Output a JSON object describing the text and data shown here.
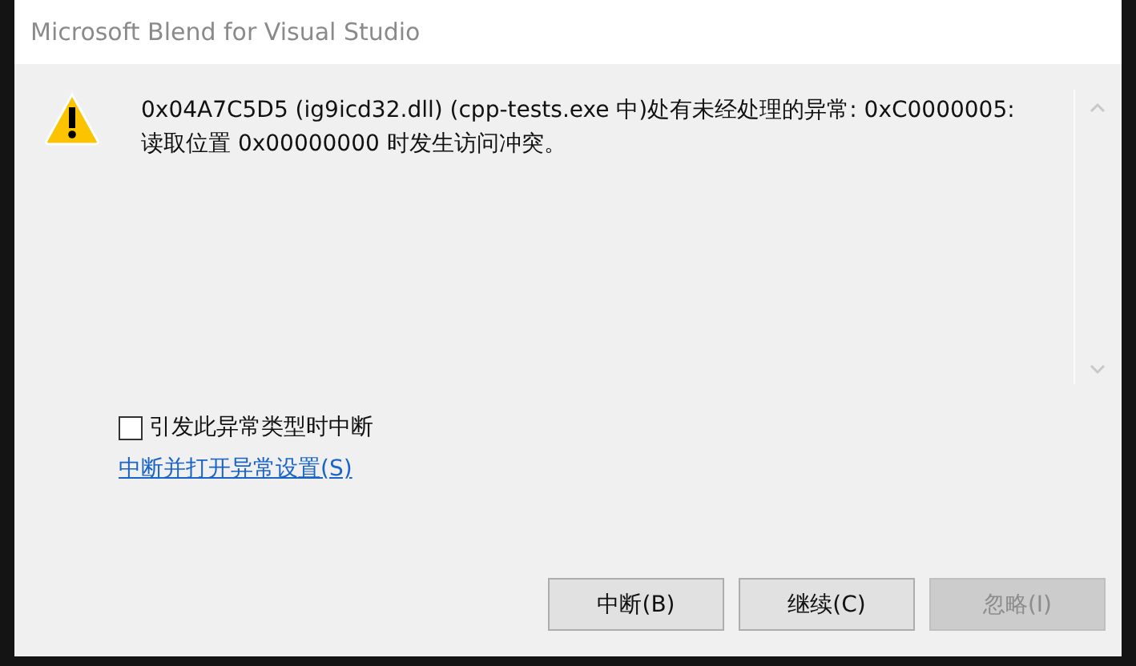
{
  "window": {
    "title": "Microsoft Blend for Visual Studio"
  },
  "message": "0x04A7C5D5 (ig9icd32.dll) (cpp-tests.exe 中)处有未经处理的异常: 0xC0000005:\n读取位置 0x00000000 时发生访问冲突。",
  "checkbox": {
    "label": "引发此异常类型时中断",
    "checked": false
  },
  "link": "中断并打开异常设置(S)",
  "buttons": [
    {
      "label": "中断(B)",
      "disabled": false
    },
    {
      "label": "继续(C)",
      "disabled": false
    },
    {
      "label": "忽略(I)",
      "disabled": true
    }
  ]
}
